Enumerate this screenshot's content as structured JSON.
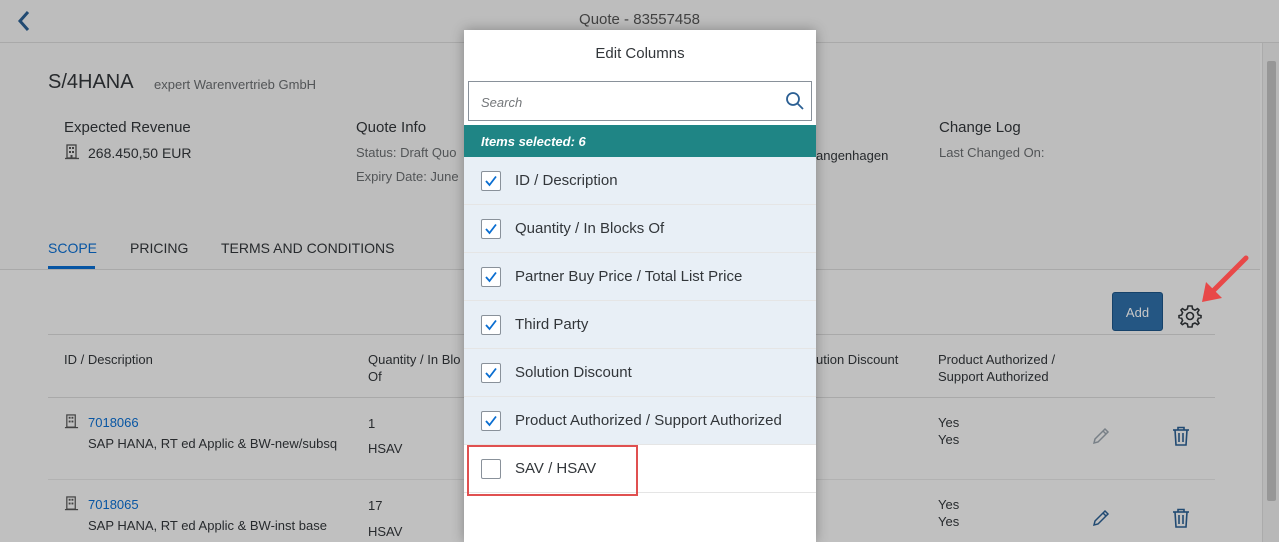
{
  "topbar": {
    "title": "Quote - 83557458"
  },
  "header": {
    "title": "S/4HANA",
    "subtitle": "expert Warenvertrieb GmbH",
    "expected_revenue": {
      "label": "Expected Revenue",
      "value": "268.450,50  EUR"
    },
    "quote_info": {
      "label": "Quote Info",
      "status": "Status: Draft Quo",
      "expiry": "Expiry Date: June"
    },
    "partial_text": "angenhagen",
    "change_log": {
      "label": "Change Log",
      "last_changed": "Last Changed On:"
    }
  },
  "tabs": [
    {
      "label": "SCOPE",
      "active": true
    },
    {
      "label": "PRICING",
      "active": false
    },
    {
      "label": "TERMS AND CONDITIONS",
      "active": false
    }
  ],
  "toolbar": {
    "add_label": "Add"
  },
  "table": {
    "columns": {
      "id_desc": "ID / Description",
      "qty_line1": "Quantity / In Blo",
      "qty_line2": "Of",
      "solution_discount": "ution Discount",
      "prod_auth_line1": "Product Authorized /",
      "prod_auth_line2": "Support Authorized"
    },
    "rows": [
      {
        "id": "7018066",
        "description": "SAP HANA, RT ed Applic & BW-new/subsq",
        "quantity": "1",
        "unit": "HSAV",
        "product_authorized": "Yes",
        "support_authorized": "Yes"
      },
      {
        "id": "7018065",
        "description": "SAP HANA, RT ed Applic & BW-inst base",
        "quantity": "17",
        "unit": "HSAV",
        "product_authorized": "Yes",
        "support_authorized": "Yes"
      }
    ]
  },
  "dialog": {
    "title": "Edit Columns",
    "search_placeholder": "Search",
    "selected_label": "Items selected: 6",
    "items": [
      {
        "label": "ID / Description",
        "checked": true
      },
      {
        "label": "Quantity / In Blocks Of",
        "checked": true
      },
      {
        "label": "Partner Buy Price / Total List Price",
        "checked": true
      },
      {
        "label": "Third Party",
        "checked": true
      },
      {
        "label": "Solution Discount",
        "checked": true
      },
      {
        "label": "Product Authorized / Support Authorized",
        "checked": true
      },
      {
        "label": "SAV / HSAV",
        "checked": false
      }
    ]
  },
  "colors": {
    "accent": "#0a6ed1",
    "selected_bar": "#1f8585",
    "highlight": "#e05050",
    "add_button": "#2f6fa8"
  }
}
